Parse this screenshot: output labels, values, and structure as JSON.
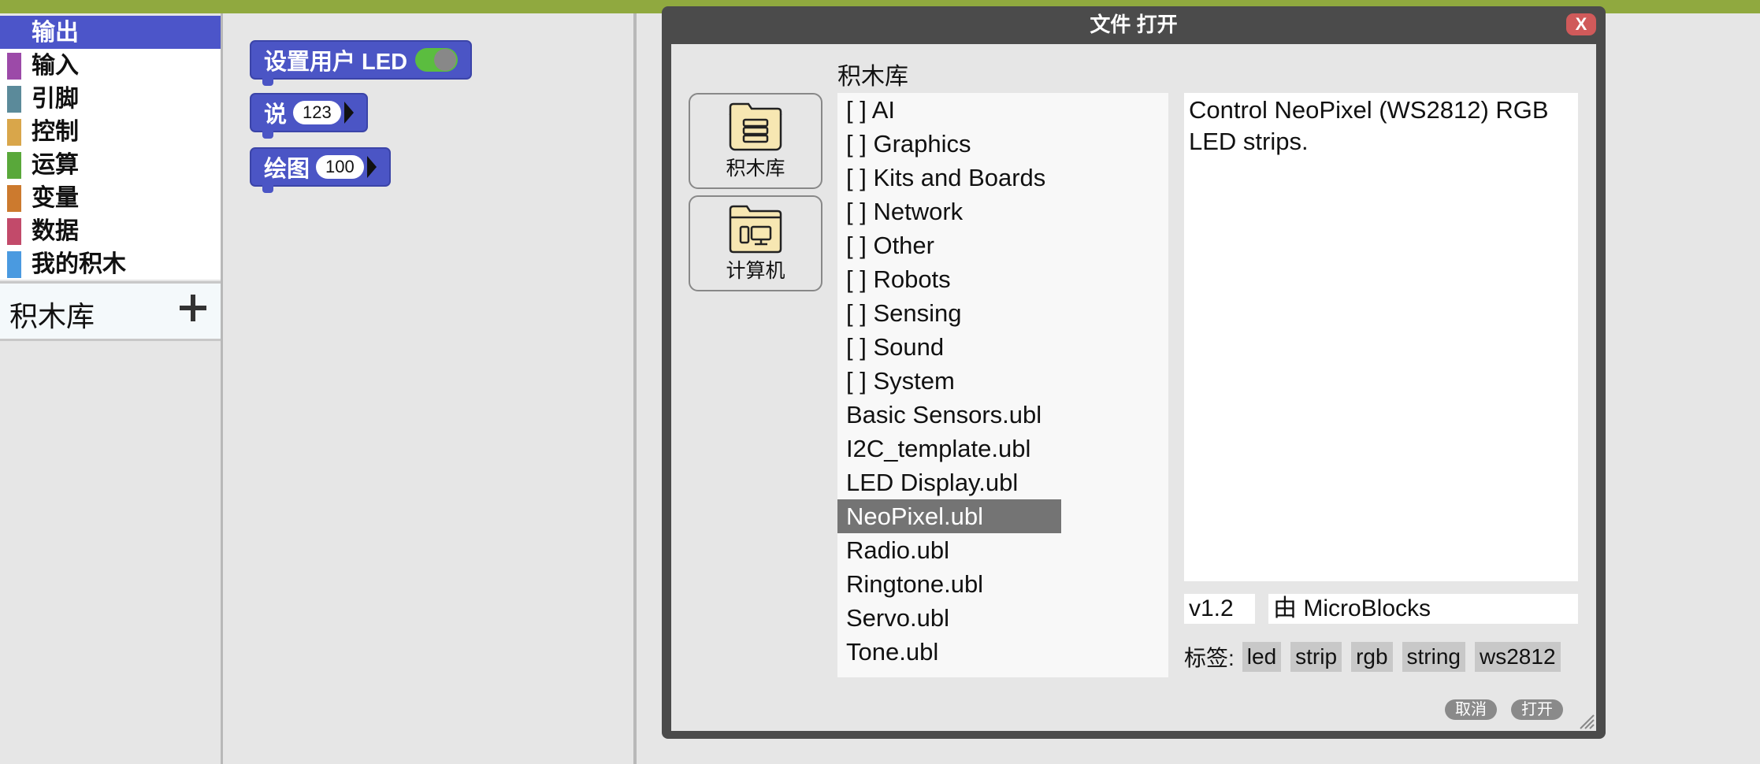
{
  "categories": [
    {
      "label": "输出",
      "color": "#4c55c9",
      "selected": true
    },
    {
      "label": "输入",
      "color": "#9c4aa8"
    },
    {
      "label": "引脚",
      "color": "#5b8a9a"
    },
    {
      "label": "控制",
      "color": "#d9a64a"
    },
    {
      "label": "运算",
      "color": "#59a83a"
    },
    {
      "label": "变量",
      "color": "#cc7a2e"
    },
    {
      "label": "数据",
      "color": "#c24a6a"
    },
    {
      "label": "我的积木",
      "color": "#4a9ae0"
    }
  ],
  "library_section": {
    "label": "积木库"
  },
  "blocks": [
    {
      "label": "设置用户 LED"
    },
    {
      "label": "说",
      "value": "123"
    },
    {
      "label": "绘图",
      "value": "100"
    }
  ],
  "dialog": {
    "title": "文件 打开",
    "close_label": "X",
    "sources": [
      {
        "label": "积木库",
        "icon": "library-book-icon"
      },
      {
        "label": "计算机",
        "icon": "computer-folder-icon"
      }
    ],
    "list_title": "积木库",
    "items": [
      "[ ] AI",
      "[ ] Graphics",
      "[ ] Kits and Boards",
      "[ ] Network",
      "[ ] Other",
      "[ ] Robots",
      "[ ] Sensing",
      "[ ] Sound",
      "[ ] System",
      "Basic Sensors.ubl",
      "I2C_template.ubl",
      "LED Display.ubl",
      "NeoPixel.ubl",
      "Radio.ubl",
      "Ringtone.ubl",
      "Servo.ubl",
      "Tone.ubl"
    ],
    "selected_item": "NeoPixel.ubl",
    "description": "Control NeoPixel (WS2812) RGB LED strips.",
    "version": "v1.2",
    "author": "由 MicroBlocks",
    "tags_label": "标签:",
    "tags": [
      "led",
      "strip",
      "rgb",
      "string",
      "ws2812"
    ],
    "cancel_label": "取消",
    "open_label": "打开"
  }
}
